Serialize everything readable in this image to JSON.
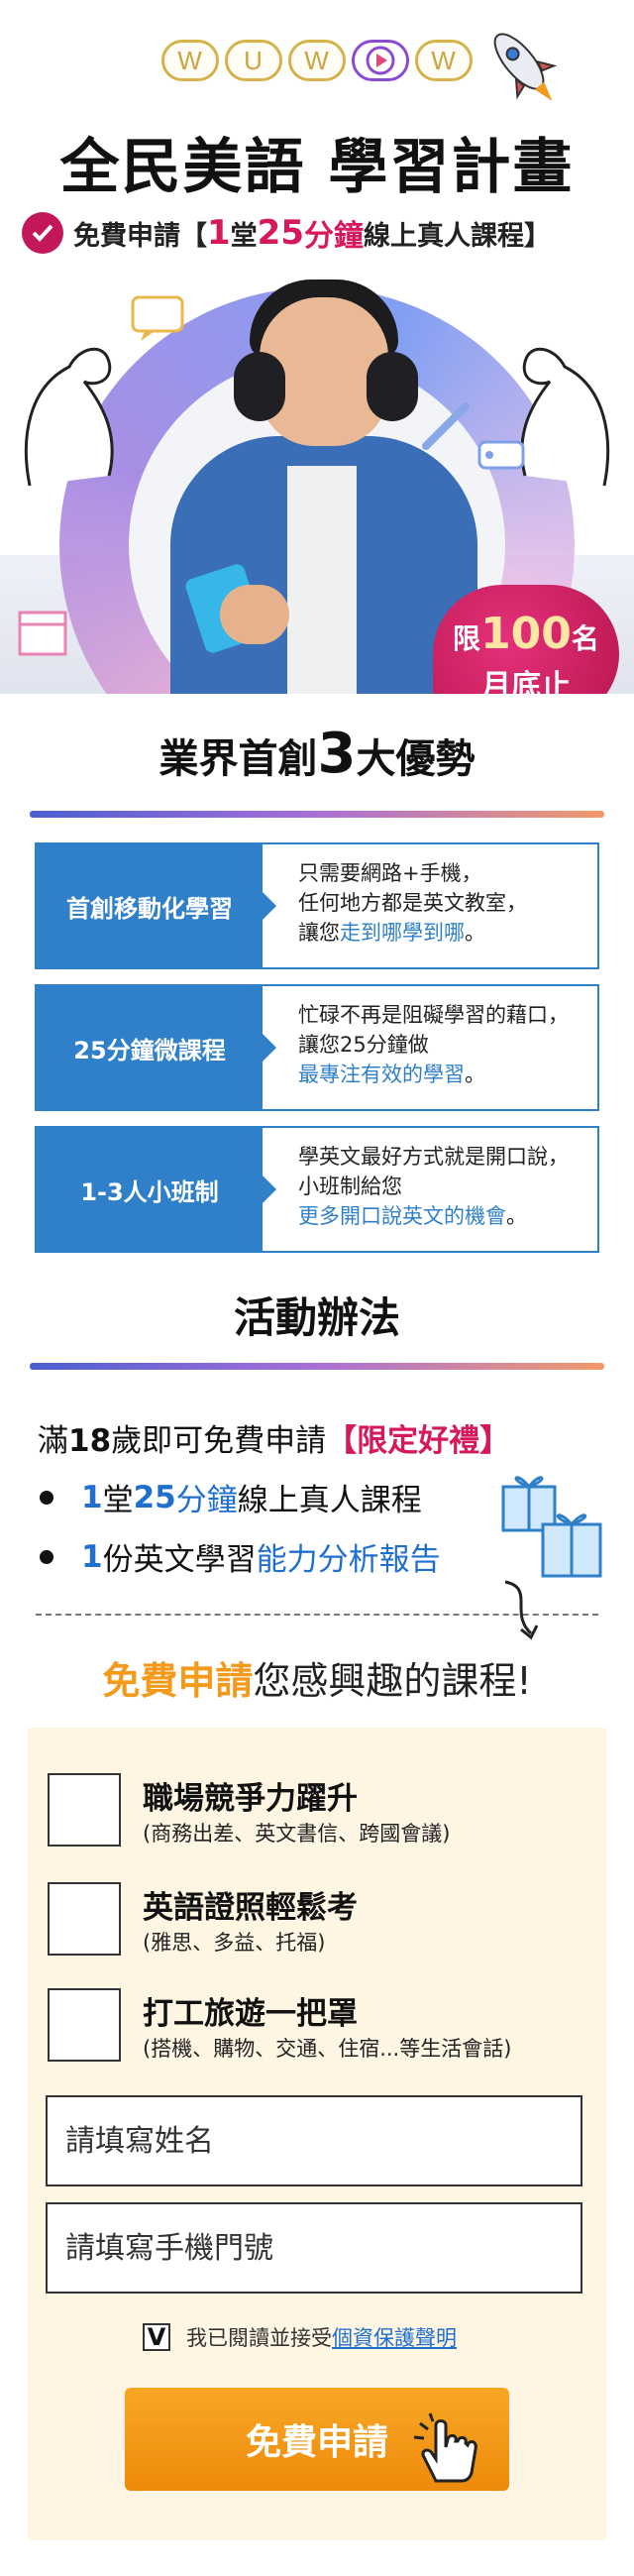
{
  "brand": {
    "logo_letters": [
      "W",
      "U",
      "W",
      "W"
    ]
  },
  "hero": {
    "title": "全民美語 學習計畫",
    "subtitle_prefix": "免費申請【",
    "subtitle_num1": "1",
    "subtitle_mid1": "堂",
    "subtitle_num2": "25",
    "subtitle_mid2": "分鐘",
    "subtitle_suffix": "線上真人課程】",
    "badge": {
      "line1": "限",
      "number": "100",
      "unit": "名",
      "line2": "月底止"
    }
  },
  "advantages": {
    "title_prefix": "業界首創",
    "title_num": "3",
    "title_suffix": "大優勢",
    "items": [
      {
        "label": "首創移動化學習",
        "line1": "只需要網路+手機，",
        "line2": "任何地方都是英文教室，",
        "line3_plain": "讓您",
        "line3_hl": "走到哪學到哪",
        "line3_end": "。"
      },
      {
        "label": "25分鐘微課程",
        "line1": "忙碌不再是阻礙學習的藉口，",
        "line2": "讓您25分鐘做",
        "line3_plain": "",
        "line3_hl": "最專注有效的學習",
        "line3_end": "。"
      },
      {
        "label": "1-3人小班制",
        "line1": "學英文最好方式就是開口說，",
        "line2": "小班制給您",
        "line3_plain": "",
        "line3_hl": "更多開口說英文的機會",
        "line3_end": "。"
      }
    ]
  },
  "activity": {
    "title": "活動辦法",
    "line_prefix": "滿",
    "line_age": "18",
    "line_mid": "歲即可免費申請",
    "line_gift": "【限定好禮】",
    "bullet1": {
      "num1": "1",
      "t1": "堂",
      "num2": "25",
      "t2": "分鐘",
      "t3": "線上真人課程"
    },
    "bullet2": {
      "num1": "1",
      "t1": "份英文學習",
      "t2": "能力分析報告"
    }
  },
  "cta": {
    "highlight": "免費申請",
    "rest": "您感興趣的課程!"
  },
  "form": {
    "options": [
      {
        "title": "職場競爭力躍升",
        "sub": "(商務出差、英文書信、跨國會議)"
      },
      {
        "title": "英語證照輕鬆考",
        "sub": "(雅思、多益、托福)"
      },
      {
        "title": "打工旅遊一把罩",
        "sub": "(搭機、購物、交通、住宿...等生活會話)"
      }
    ],
    "name_placeholder": "請填寫姓名",
    "phone_placeholder": "請填寫手機門號",
    "agree_mark": "V",
    "agree_text": "我已閱讀並接受",
    "agree_link": "個資保護聲明",
    "submit_label": "免費申請"
  },
  "colors": {
    "accent_blue": "#2f80c8",
    "accent_pink": "#d6185c",
    "accent_orange": "#f39a1d",
    "form_bg": "#fef5e2"
  }
}
